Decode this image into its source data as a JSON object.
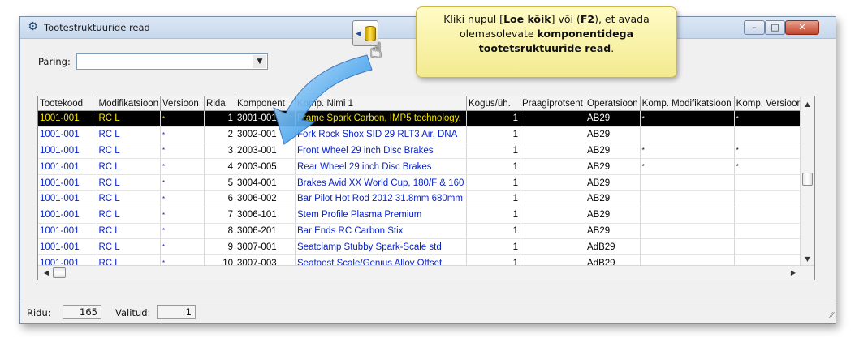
{
  "window": {
    "title": "Tootestruktuuride read",
    "min_symbol": "–",
    "max_symbol": "□",
    "close_symbol": "✕"
  },
  "query": {
    "label": "Päring:",
    "value": ""
  },
  "tooltip": {
    "t1": "Kliki nupul [",
    "t2": "Loe kõik",
    "t3": "] või (",
    "t4": "F2",
    "t5": "), et avada",
    "t6": "olemasolevate ",
    "t7": "komponentidega",
    "t8": "tootetsruktuuride read",
    "t9": "."
  },
  "table": {
    "columns": [
      "Tootekood",
      "Modifikatsioon",
      "Versioon",
      "Rida",
      "Komponent",
      "Komp. Nimi 1",
      "Kogus/üh.",
      "Praagiprotsent",
      "Operatsioon",
      "Komp. Modifikatsioon",
      "Komp. Versioon"
    ],
    "rows": [
      {
        "tootekood": "1001-001",
        "modifikatsioon": "RC L",
        "versioon": "*",
        "rida": "1",
        "komponent": "3001-001",
        "nimi": "Frame Spark Carbon, IMP5 technology,",
        "kogus": "1",
        "praak": "",
        "operatsioon": "AB29",
        "komp_mod": "*",
        "komp_ver": "*"
      },
      {
        "tootekood": "1001-001",
        "modifikatsioon": "RC L",
        "versioon": "*",
        "rida": "2",
        "komponent": "3002-001",
        "nimi": "Fork Rock Shox SID 29 RLT3 Air, DNA",
        "kogus": "1",
        "praak": "",
        "operatsioon": "AB29",
        "komp_mod": "",
        "komp_ver": ""
      },
      {
        "tootekood": "1001-001",
        "modifikatsioon": "RC L",
        "versioon": "*",
        "rida": "3",
        "komponent": "2003-001",
        "nimi": "Front Wheel 29 inch Disc Brakes",
        "kogus": "1",
        "praak": "",
        "operatsioon": "AB29",
        "komp_mod": "*",
        "komp_ver": "*"
      },
      {
        "tootekood": "1001-001",
        "modifikatsioon": "RC L",
        "versioon": "*",
        "rida": "4",
        "komponent": "2003-005",
        "nimi": "Rear Wheel 29 inch Disc Brakes",
        "kogus": "1",
        "praak": "",
        "operatsioon": "AB29",
        "komp_mod": "*",
        "komp_ver": "*"
      },
      {
        "tootekood": "1001-001",
        "modifikatsioon": "RC L",
        "versioon": "*",
        "rida": "5",
        "komponent": "3004-001",
        "nimi": "Brakes Avid XX World Cup, 180/F & 160",
        "kogus": "1",
        "praak": "",
        "operatsioon": "AB29",
        "komp_mod": "",
        "komp_ver": ""
      },
      {
        "tootekood": "1001-001",
        "modifikatsioon": "RC L",
        "versioon": "*",
        "rida": "6",
        "komponent": "3006-002",
        "nimi": "Bar Pilot Hot Rod 2012 31.8mm 680mm",
        "kogus": "1",
        "praak": "",
        "operatsioon": "AB29",
        "komp_mod": "",
        "komp_ver": ""
      },
      {
        "tootekood": "1001-001",
        "modifikatsioon": "RC L",
        "versioon": "*",
        "rida": "7",
        "komponent": "3006-101",
        "nimi": "Stem Profile Plasma Premium",
        "kogus": "1",
        "praak": "",
        "operatsioon": "AB29",
        "komp_mod": "",
        "komp_ver": ""
      },
      {
        "tootekood": "1001-001",
        "modifikatsioon": "RC L",
        "versioon": "*",
        "rida": "8",
        "komponent": "3006-201",
        "nimi": "Bar Ends RC Carbon Stix",
        "kogus": "1",
        "praak": "",
        "operatsioon": "AB29",
        "komp_mod": "",
        "komp_ver": ""
      },
      {
        "tootekood": "1001-001",
        "modifikatsioon": "RC L",
        "versioon": "*",
        "rida": "9",
        "komponent": "3007-001",
        "nimi": "Seatclamp Stubby Spark-Scale std",
        "kogus": "1",
        "praak": "",
        "operatsioon": "AdB29",
        "komp_mod": "",
        "komp_ver": ""
      },
      {
        "tootekood": "1001-001",
        "modifikatsioon": "RC L",
        "versioon": "*",
        "rida": "10",
        "komponent": "3007-003",
        "nimi": "Seatpost Scale/Genius Alloy Offset",
        "kogus": "1",
        "praak": "",
        "operatsioon": "AdB29",
        "komp_mod": "",
        "komp_ver": ""
      }
    ]
  },
  "status": {
    "rows_label": "Ridu:",
    "rows_value": "165",
    "selected_label": "Valitud:",
    "selected_value": "1"
  },
  "colors": {
    "selected_row_bg": "#000000",
    "selected_row_text": "#f5e400",
    "row_text": "#0a24c8",
    "tooltip_bg": "#fff6a8",
    "arrow": "#2f8fe0"
  }
}
